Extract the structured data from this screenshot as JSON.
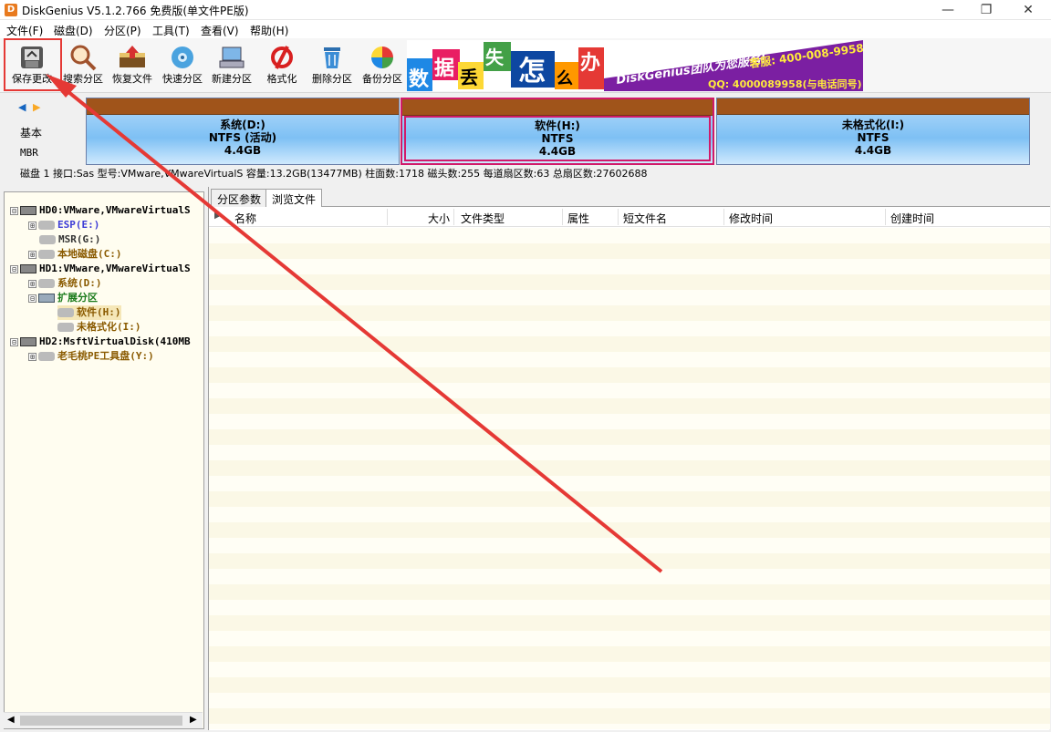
{
  "window": {
    "title": "DiskGenius V5.1.2.766 免费版(单文件PE版)",
    "app_icon_letter": "D",
    "controls": [
      "—",
      "❐",
      "✕"
    ]
  },
  "menu": [
    "文件(F)",
    "磁盘(D)",
    "分区(P)",
    "工具(T)",
    "查看(V)",
    "帮助(H)"
  ],
  "toolbar": {
    "buttons": [
      {
        "label": "保存更改",
        "icon": "save-icon"
      },
      {
        "label": "搜索分区",
        "icon": "search-icon"
      },
      {
        "label": "恢复文件",
        "icon": "recover-icon"
      },
      {
        "label": "快速分区",
        "icon": "quick-partition-icon"
      },
      {
        "label": "新建分区",
        "icon": "new-partition-icon"
      },
      {
        "label": "格式化",
        "icon": "format-icon"
      },
      {
        "label": "删除分区",
        "icon": "delete-icon"
      },
      {
        "label": "备份分区",
        "icon": "backup-icon"
      }
    ]
  },
  "banner": {
    "chars": [
      "数",
      "据",
      "丢",
      "失",
      "怎",
      "么",
      "办"
    ],
    "slogan": "DiskGenius团队为您服务!",
    "phone": "客服: 400-008-9958",
    "qq": "QQ: 4000089958(与电话同号)"
  },
  "disk_map": {
    "nav_prev": "◀",
    "nav_next": "▶",
    "type": "基本",
    "scheme": "MBR",
    "partitions": [
      {
        "name": "系统(D:)",
        "fs": "NTFS (活动)",
        "size": "4.4GB",
        "selected": false
      },
      {
        "name": "软件(H:)",
        "fs": "NTFS",
        "size": "4.4GB",
        "selected": true
      },
      {
        "name": "未格式化(I:)",
        "fs": "NTFS",
        "size": "4.4GB",
        "selected": false
      }
    ]
  },
  "disk_info": "磁盘 1 接口:Sas  型号:VMware,VMwareVirtualS  容量:13.2GB(13477MB)  柱面数:1718  磁头数:255  每道扇区数:63  总扇区数:27602688",
  "tree": [
    {
      "text": "HD0:VMware,VMwareVirtualS",
      "kind": "disk",
      "color": "#000000",
      "expander": "⊟"
    },
    {
      "text": "ESP(E:)",
      "kind": "part",
      "color": "#3b3bd6",
      "expander": "⊞"
    },
    {
      "text": "MSR(G:)",
      "kind": "part",
      "color": "#333333",
      "expander": ""
    },
    {
      "text": "本地磁盘(C:)",
      "kind": "part",
      "color": "#8a5a00",
      "expander": "⊞"
    },
    {
      "text": "HD1:VMware,VMwareVirtualS",
      "kind": "disk",
      "color": "#000000",
      "expander": "⊟"
    },
    {
      "text": "系统(D:)",
      "kind": "part",
      "color": "#8a5a00",
      "expander": "⊞"
    },
    {
      "text": "扩展分区",
      "kind": "ext",
      "color": "#1a7a1a",
      "expander": "⊟"
    },
    {
      "text": "软件(H:)",
      "kind": "part",
      "color": "#8a5a00",
      "expander": "",
      "selected": true
    },
    {
      "text": "未格式化(I:)",
      "kind": "part",
      "color": "#8a5a00",
      "expander": ""
    },
    {
      "text": "HD2:MsftVirtualDisk(410MB",
      "kind": "disk",
      "color": "#000000",
      "expander": "⊟"
    },
    {
      "text": "老毛桃PE工具盘(Y:)",
      "kind": "part",
      "color": "#8a5a00",
      "expander": "⊞"
    }
  ],
  "tabs": [
    "分区参数",
    "浏览文件"
  ],
  "columns": [
    "名称",
    "大小",
    "文件类型",
    "属性",
    "短文件名",
    "修改时间",
    "创建时间"
  ],
  "scroll": {
    "left": "◀",
    "right": "▶"
  },
  "colors": {
    "highlight": "#e53935",
    "selected_partition": "#d11a6a",
    "partition_cap": "#a0541a"
  }
}
